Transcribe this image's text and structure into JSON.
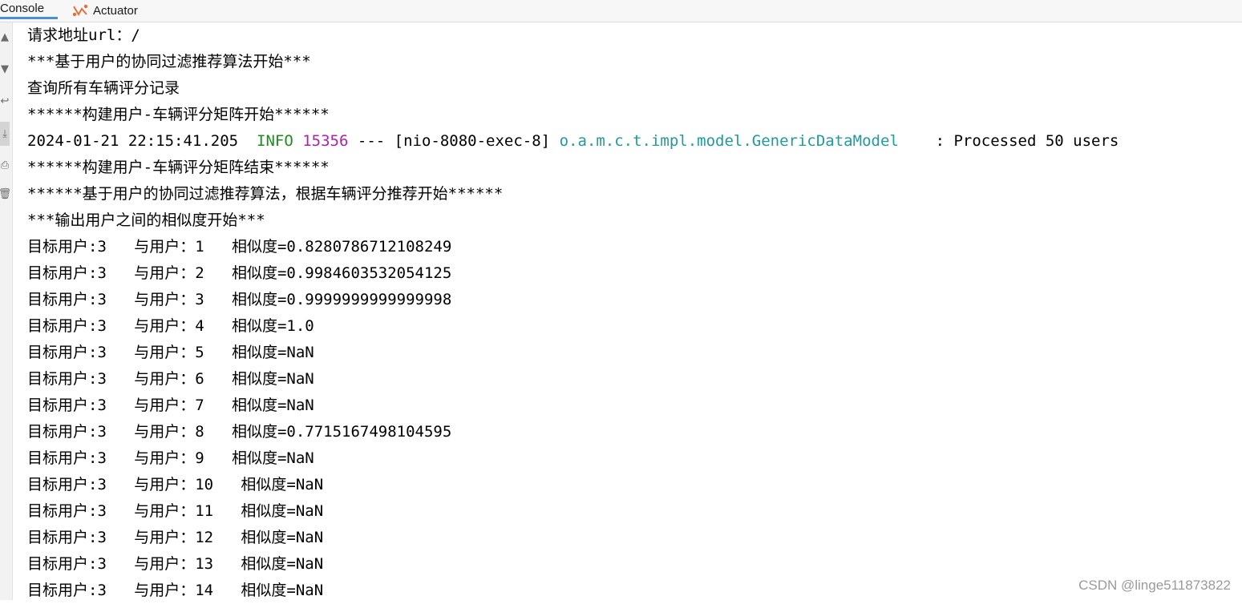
{
  "tabs": {
    "console_label": "Console",
    "actuator_label": "Actuator"
  },
  "gutter_icons": [
    "up-arrow-icon",
    "down-arrow-icon",
    "soft-wrap-icon",
    "scroll-to-end-icon",
    "print-icon",
    "clear-all-icon"
  ],
  "console": {
    "lines": [
      "请求地址url：/",
      "***基于用户的协同过滤推荐算法开始***",
      "查询所有车辆评分记录",
      "******构建用户-车辆评分矩阵开始******",
      null,
      "******构建用户-车辆评分矩阵结束******",
      "******基于用户的协同过滤推荐算法，根据车辆评分推荐开始******",
      "***输出用户之间的相似度开始***",
      "目标用户:3   与用户：1   相似度=0.8280786712108249",
      "目标用户:3   与用户：2   相似度=0.9984603532054125",
      "目标用户:3   与用户：3   相似度=0.9999999999999998",
      "目标用户:3   与用户：4   相似度=1.0",
      "目标用户:3   与用户：5   相似度=NaN",
      "目标用户:3   与用户：6   相似度=NaN",
      "目标用户:3   与用户：7   相似度=NaN",
      "目标用户:3   与用户：8   相似度=0.7715167498104595",
      "目标用户:3   与用户：9   相似度=NaN",
      "目标用户:3   与用户：10   相似度=NaN",
      "目标用户:3   与用户：11   相似度=NaN",
      "目标用户:3   与用户：12   相似度=NaN",
      "目标用户:3   与用户：13   相似度=NaN",
      "目标用户:3   与用户：14   相似度=NaN"
    ],
    "log": {
      "timestamp": "2024-01-21 22:15:41.205",
      "level": "INFO",
      "pid": "15356",
      "separator": "---",
      "thread": "[nio-8080-exec-8]",
      "logger": "o.a.m.c.t.impl.model.GenericDataModel",
      "message": ": Processed 50 users"
    }
  },
  "colors": {
    "info": "#1e8c1e",
    "pid": "#b020b0",
    "logger": "#1f9ba0"
  },
  "watermark": "CSDN @linge511873822"
}
